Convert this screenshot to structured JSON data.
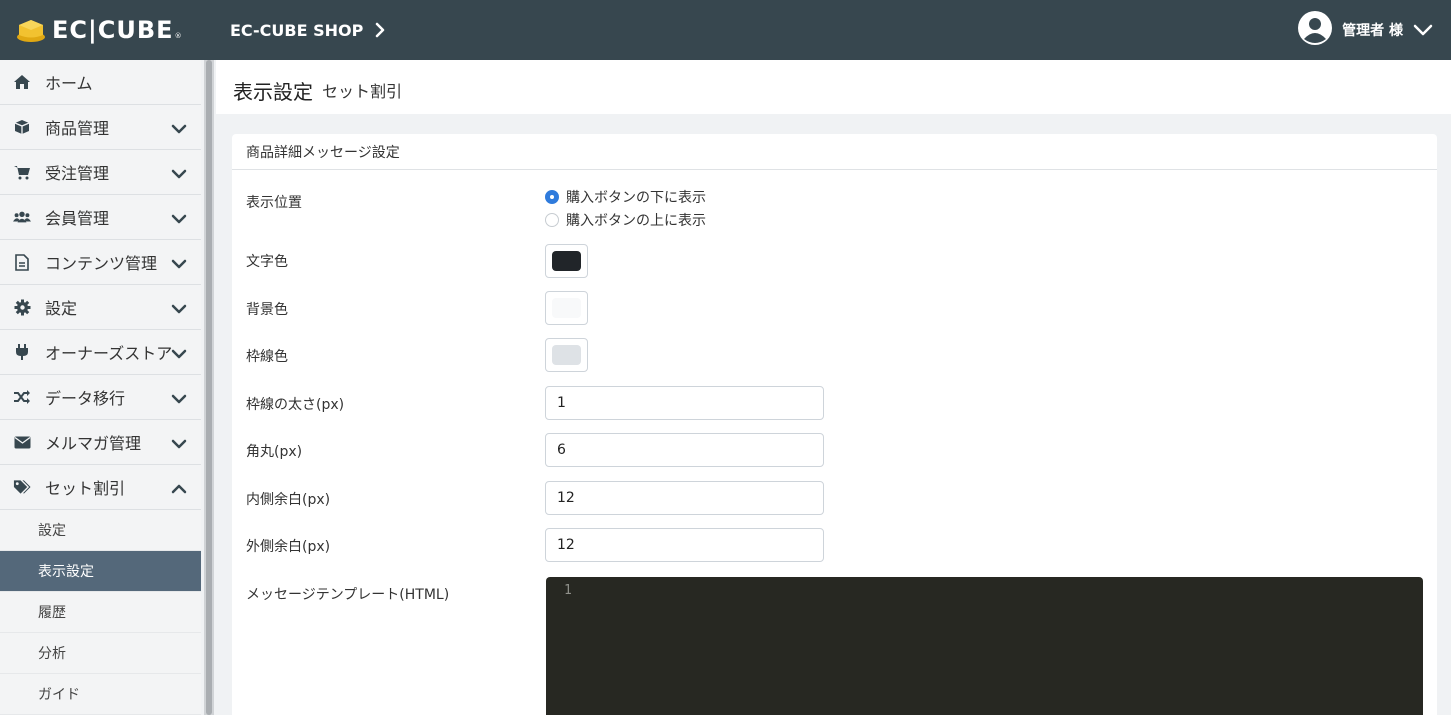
{
  "header": {
    "logo_text": "EC|CUBE",
    "logo_mark": "®",
    "shop_name": "EC-CUBE SHOP",
    "user_name": "管理者 様",
    "colors": {
      "bar": "#37474f",
      "logo_cube": "#f2c230"
    }
  },
  "sidebar": {
    "items": [
      {
        "label": "ホーム",
        "icon": "home-icon",
        "chevron": "none"
      },
      {
        "label": "商品管理",
        "icon": "box-icon",
        "chevron": "down"
      },
      {
        "label": "受注管理",
        "icon": "cart-icon",
        "chevron": "down"
      },
      {
        "label": "会員管理",
        "icon": "users-icon",
        "chevron": "down"
      },
      {
        "label": "コンテンツ管理",
        "icon": "file-icon",
        "chevron": "down"
      },
      {
        "label": "設定",
        "icon": "gear-icon",
        "chevron": "down"
      },
      {
        "label": "オーナーズストア",
        "icon": "plug-icon",
        "chevron": "down"
      },
      {
        "label": "データ移行",
        "icon": "shuffle-icon",
        "chevron": "down"
      },
      {
        "label": "メルマガ管理",
        "icon": "envelope-icon",
        "chevron": "down"
      },
      {
        "label": "セット割引",
        "icon": "tags-icon",
        "chevron": "up"
      }
    ],
    "subitems": [
      {
        "label": "設定",
        "active": false
      },
      {
        "label": "表示設定",
        "active": true
      },
      {
        "label": "履歴",
        "active": false
      },
      {
        "label": "分析",
        "active": false
      },
      {
        "label": "ガイド",
        "active": false
      }
    ],
    "active_color": "#54687a"
  },
  "page": {
    "title": "表示設定",
    "subtitle": "セット割引"
  },
  "card": {
    "header": "商品詳細メッセージ設定",
    "fields": {
      "position": {
        "label": "表示位置",
        "options": [
          "購入ボタンの下に表示",
          "購入ボタンの上に表示"
        ],
        "selected_index": 0
      },
      "text_color": {
        "label": "文字色",
        "value": "#212529"
      },
      "bg_color": {
        "label": "背景色",
        "value": "#f8f9fa"
      },
      "border_color": {
        "label": "枠線色",
        "value": "#dee2e6"
      },
      "border_width": {
        "label": "枠線の太さ(px)",
        "value": "1"
      },
      "radius": {
        "label": "角丸(px)",
        "value": "6"
      },
      "padding": {
        "label": "内側余白(px)",
        "value": "12"
      },
      "margin": {
        "label": "外側余白(px)",
        "value": "12"
      },
      "template": {
        "label": "メッセージテンプレート(HTML)",
        "line_number": "1"
      }
    }
  }
}
